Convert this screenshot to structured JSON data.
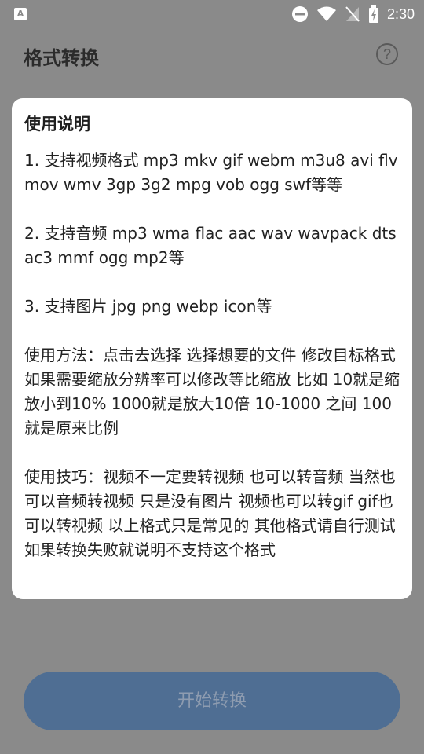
{
  "status_bar": {
    "left_icon_label": "A",
    "time": "2:30",
    "icons": [
      "do-not-disturb-icon",
      "wifi-icon",
      "no-sim-icon",
      "battery-charging-icon"
    ]
  },
  "app_bar": {
    "title": "格式转换",
    "help_icon_glyph": "?"
  },
  "dialog": {
    "title": "使用说明",
    "paragraphs": [
      "1. 支持视频格式 mp3 mkv gif webm m3u8 avi flv mov wmv 3gp 3g2 mpg vob ogg swf等等",
      "2. 支持音频 mp3 wma flac aac wav wavpack dts ac3 mmf ogg mp2等",
      "3. 支持图片 jpg png webp icon等",
      "使用方法：点击去选择 选择想要的文件 修改目标格式 如果需要缩放分辨率可以修改等比缩放 比如 10就是缩放小到10% 1000就是放大10倍 10-1000 之间 100就是原来比例",
      "使用技巧：视频不一定要转视频 也可以转音频 当然也可以音频转视频 只是没有图片 视频也可以转gif gif也可以转视频 以上格式只是常见的 其他格式请自行测试 如果转换失败就说明不支持这个格式"
    ]
  },
  "start_button": {
    "label": "开始转换"
  },
  "colors": {
    "scrim": "#8a8a8a",
    "button": "#4f6e93",
    "dialog_bg": "#ffffff"
  }
}
